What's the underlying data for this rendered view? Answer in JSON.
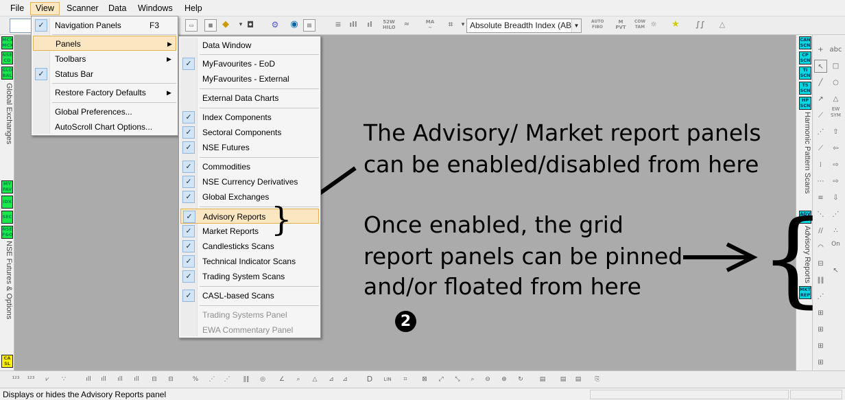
{
  "menubar": {
    "items": [
      {
        "label": "File",
        "key": "F"
      },
      {
        "label": "View",
        "key": "V"
      },
      {
        "label": "Scanner",
        "key": "S"
      },
      {
        "label": "Data",
        "key": "D"
      },
      {
        "label": "Windows",
        "key": "W"
      },
      {
        "label": "Help",
        "key": "H"
      }
    ],
    "active": "View"
  },
  "toolbar": {
    "breadth_select": "Absolute Breadth Index (ABI"
  },
  "view_menu": {
    "items": [
      {
        "label": "Navigation Panels",
        "shortcut": "F3",
        "checked": true
      },
      {
        "label": "Panels",
        "submenu": true,
        "highlighted": true
      },
      {
        "label": "Toolbars",
        "submenu": true
      },
      {
        "label": "Status Bar",
        "checked": true
      },
      {
        "label": "Restore Factory Defaults",
        "submenu": true
      },
      {
        "label": "Global Preferences..."
      },
      {
        "label": "AutoScroll Chart Options..."
      }
    ]
  },
  "panels_submenu": {
    "items": [
      {
        "label": "Data Window",
        "checked": false
      },
      {
        "label": "MyFavourites - EoD",
        "checked": true
      },
      {
        "label": "MyFavourites - External",
        "checked": false
      },
      {
        "label": "External Data Charts",
        "checked": false
      },
      {
        "label": "Index Components",
        "checked": true
      },
      {
        "label": "Sectoral Components",
        "checked": true
      },
      {
        "label": "NSE Futures",
        "checked": true
      },
      {
        "label": "Commodities",
        "checked": true
      },
      {
        "label": "NSE Currency Derivatives",
        "checked": true
      },
      {
        "label": "Global Exchanges",
        "checked": true
      },
      {
        "label": "Advisory Reports",
        "checked": true,
        "highlighted": true
      },
      {
        "label": "Market Reports",
        "checked": true
      },
      {
        "label": "Candlesticks Scans",
        "checked": true
      },
      {
        "label": "Technical Indicator Scans",
        "checked": true
      },
      {
        "label": "Trading System Scans",
        "checked": true
      },
      {
        "label": "CASL-based Scans",
        "checked": true
      },
      {
        "label": "Trading Systems Panel",
        "disabled": true
      },
      {
        "label": "EWA Commentary Panel",
        "disabled": true
      }
    ]
  },
  "left_panel": {
    "group1_buttons": [
      "MCX\nMCX",
      "NSE\nCD",
      "GLO\nBAL"
    ],
    "group1_label": "Global Exchanges",
    "group2_buttons": [
      "MY\nFAV",
      "IDX",
      "SEC",
      "NSE\nF&O"
    ],
    "group2_label": "NSE Futures & Options",
    "casl_button": "CA\nSL"
  },
  "right_panel": {
    "scan_buttons": [
      "CAN\nSCN",
      "CP\nSCN",
      "TI\nSCN",
      "TS\nSCN",
      "HP\nSCN"
    ],
    "scan_label": "Harmonic Pattern Scans",
    "report_buttons": [
      "ADV\nREP",
      "MKT\nREP"
    ],
    "report_label": "Advisory Reports"
  },
  "drawing_tools": {
    "text_tool": "abc",
    "ew_label": "EW\nSYM",
    "on_label": "On"
  },
  "annotations": {
    "line1": "The Advisory/ Market report panels",
    "line2": "can be enabled/disabled from here",
    "line3": "Once enabled, the grid",
    "line4": "report panels can be pinned",
    "line5": "and/or floated from here",
    "marker": "❷",
    "brace_small": "}",
    "brace_big": "{"
  },
  "statusbar": {
    "text": "Displays or hides the Advisory Reports panel"
  },
  "colors": {
    "menu_highlight": "#fbe6c2",
    "nav_green": "#18e84a",
    "nav_cyan": "#0ad6e0",
    "casl_yellow": "#fcf300",
    "workspace_gray": "#ababab"
  }
}
